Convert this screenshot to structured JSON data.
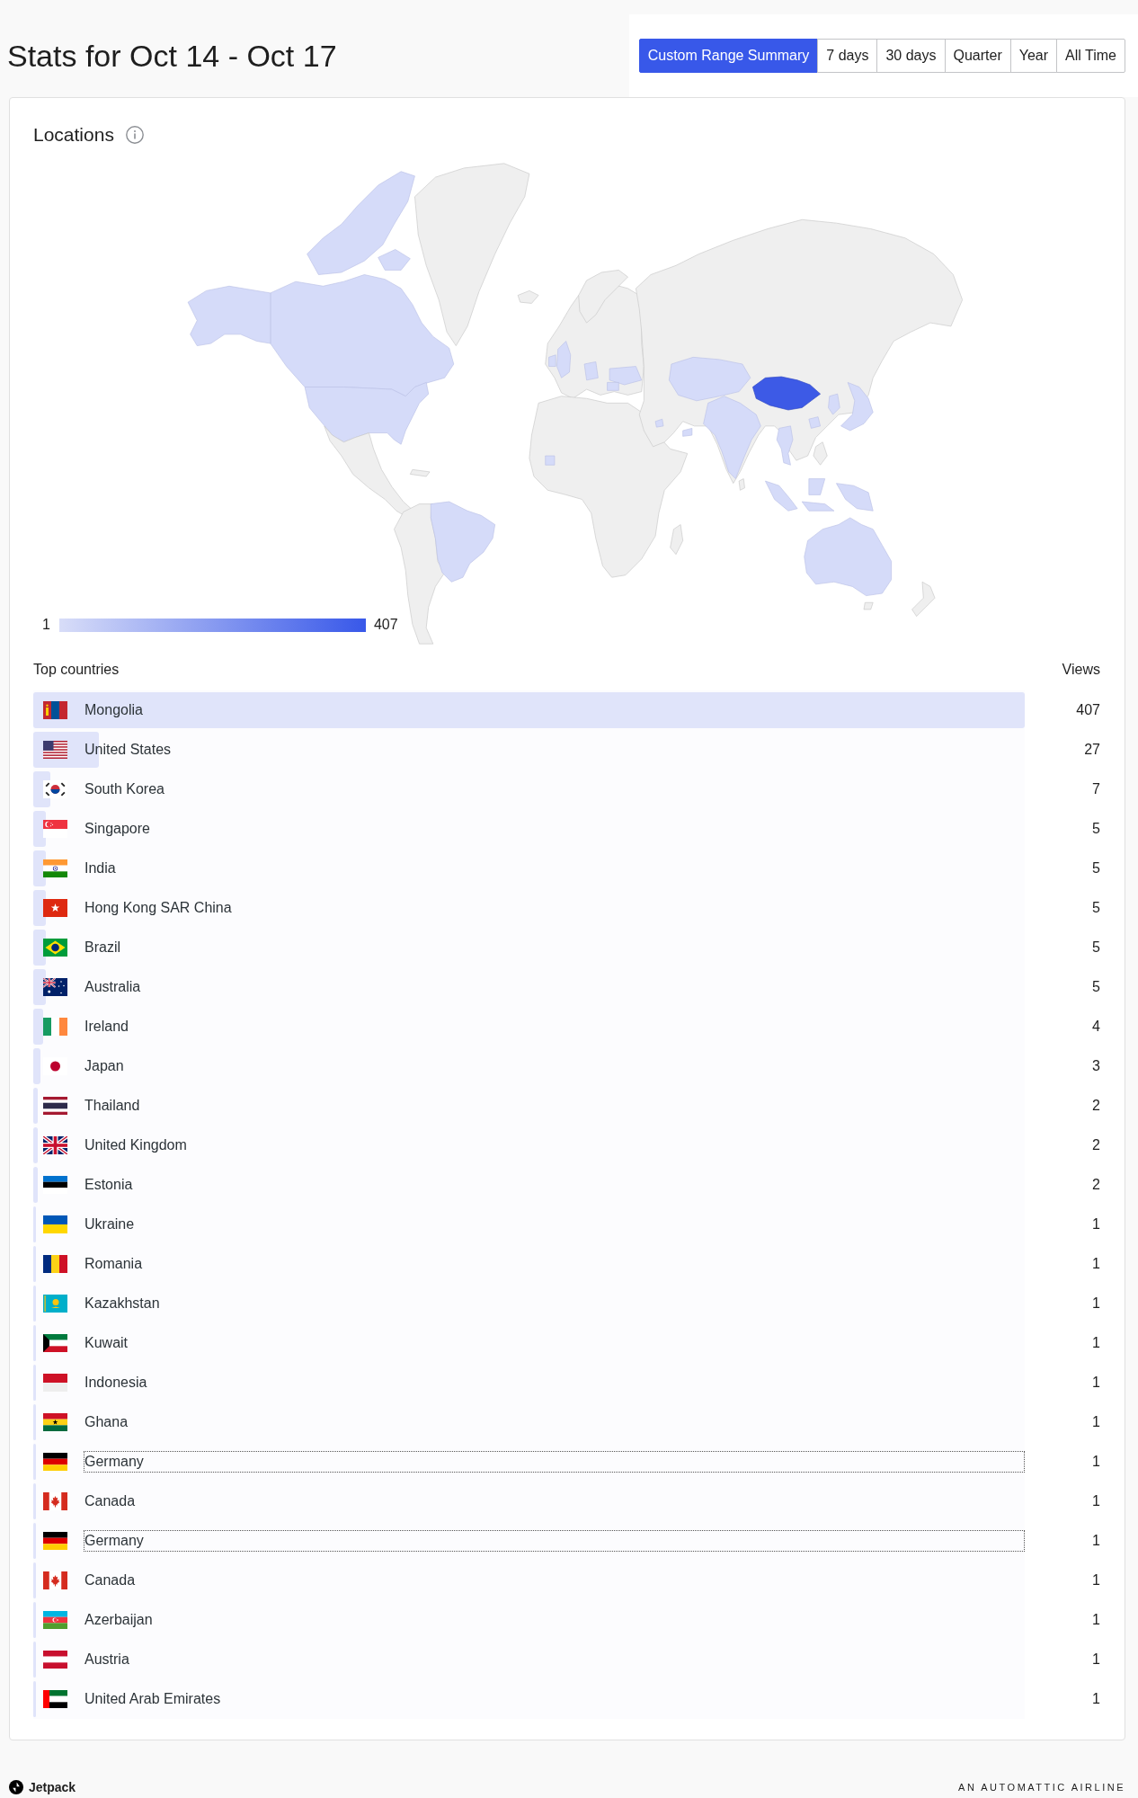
{
  "header": {
    "title": "Stats for Oct 14 - Oct 17",
    "periods": [
      {
        "label": "Custom Range Summary",
        "selected": true
      },
      {
        "label": "7 days",
        "selected": false
      },
      {
        "label": "30 days",
        "selected": false
      },
      {
        "label": "Quarter",
        "selected": false
      },
      {
        "label": "Year",
        "selected": false
      },
      {
        "label": "All Time",
        "selected": false
      }
    ]
  },
  "locations": {
    "title": "Locations",
    "legend": {
      "min": "1",
      "max": "407"
    },
    "table": {
      "columns": [
        "Top countries",
        "Views"
      ],
      "rows": [
        {
          "kind": "mn",
          "name": "Mongolia",
          "views": "407",
          "level": 1,
          "focused": false
        },
        {
          "kind": "us",
          "name": "United States",
          "views": "27",
          "level": 0.0663,
          "focused": false
        },
        {
          "kind": "kr",
          "name": "South Korea",
          "views": "7",
          "level": 0.0172,
          "focused": false
        },
        {
          "kind": "sg",
          "name": "Singapore",
          "views": "5",
          "level": 0.0123,
          "focused": false
        },
        {
          "kind": "in",
          "name": "India",
          "views": "5",
          "level": 0.0123,
          "focused": false
        },
        {
          "kind": "hk",
          "name": "Hong Kong SAR China",
          "views": "5",
          "level": 0.0123,
          "focused": false
        },
        {
          "kind": "br",
          "name": "Brazil",
          "views": "5",
          "level": 0.0123,
          "focused": false
        },
        {
          "kind": "au",
          "name": "Australia",
          "views": "5",
          "level": 0.0123,
          "focused": false
        },
        {
          "kind": "ie",
          "name": "Ireland",
          "views": "4",
          "level": 0.0098,
          "focused": false
        },
        {
          "kind": "jp",
          "name": "Japan",
          "views": "3",
          "level": 0.0074,
          "focused": false
        },
        {
          "kind": "th",
          "name": "Thailand",
          "views": "2",
          "level": 0.0049,
          "focused": false
        },
        {
          "kind": "gb",
          "name": "United Kingdom",
          "views": "2",
          "level": 0.0049,
          "focused": false
        },
        {
          "kind": "ee",
          "name": "Estonia",
          "views": "2",
          "level": 0.0049,
          "focused": false
        },
        {
          "kind": "ua",
          "name": "Ukraine",
          "views": "1",
          "level": 0.0025,
          "focused": false
        },
        {
          "kind": "ro",
          "name": "Romania",
          "views": "1",
          "level": 0.0025,
          "focused": false
        },
        {
          "kind": "kz",
          "name": "Kazakhstan",
          "views": "1",
          "level": 0.0025,
          "focused": false
        },
        {
          "kind": "kw",
          "name": "Kuwait",
          "views": "1",
          "level": 0.0025,
          "focused": false
        },
        {
          "kind": "id",
          "name": "Indonesia",
          "views": "1",
          "level": 0.0025,
          "focused": false
        },
        {
          "kind": "gh",
          "name": "Ghana",
          "views": "1",
          "level": 0.0025,
          "focused": false
        },
        {
          "kind": "de",
          "name": "Germany",
          "views": "1",
          "level": 0.0025,
          "focused": true
        },
        {
          "kind": "ca",
          "name": "Canada",
          "views": "1",
          "level": 0.0025,
          "focused": false
        },
        {
          "kind": "de",
          "name": "Germany",
          "views": "1",
          "level": 0.0025,
          "focused": true
        },
        {
          "kind": "ca",
          "name": "Canada",
          "views": "1",
          "level": 0.0025,
          "focused": false
        },
        {
          "kind": "az",
          "name": "Azerbaijan",
          "views": "1",
          "level": 0.0025,
          "focused": false
        },
        {
          "kind": "at",
          "name": "Austria",
          "views": "1",
          "level": 0.0025,
          "focused": false
        },
        {
          "kind": "ae",
          "name": "United Arab Emirates",
          "views": "1",
          "level": 0.0025,
          "focused": false
        }
      ]
    }
  },
  "footer": {
    "brand": "Jetpack",
    "tagline": "AN AUTOMATTIC AIRLINE"
  }
}
